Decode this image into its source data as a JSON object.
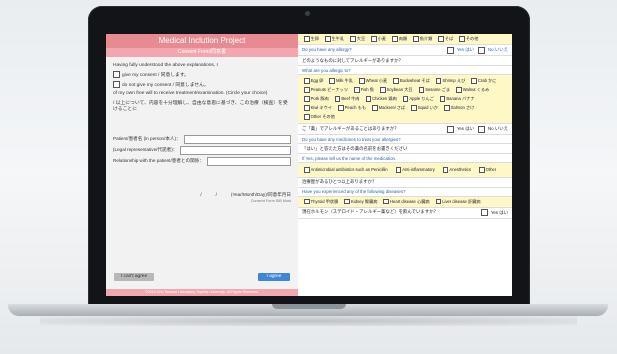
{
  "form": {
    "title": "Medical Inclution Project",
    "subtitle": "Consent Form/同意書",
    "intro": "Having fully understood the above explanations, I",
    "option1": "give my consent / 同意します。",
    "option2": "do not give my consent / 同意しません。",
    "treatment": "of my own free will to receive treatment/examination. (Circle your choice)",
    "jp_text": "/ 以上について、内容を十分理解し、自由な意思に基づき、この治療（検査）を受けることに",
    "patient_label": "Patient/患者名 (in person/本人)：",
    "rep_label": "(Legal representative/代諾者)：",
    "relation_label": "Relationship with the patient/患者との関係：",
    "date_slash1": "/",
    "date_slash2": "/",
    "date_label": "(Year/Month/Day)/同意年月日",
    "note": "Consent Form SiB Must",
    "cant_agree": "I can't agree",
    "agree": "I agree",
    "footer": "©2015 Ohu Takuma Laboratory, Sophia University, All Rights Reserved."
  },
  "right": {
    "q1_en": "Do you have any allergy?",
    "q1_jp": "どのようなものに対してアレルギーがありますか？",
    "q2_en": "What are you allergic to?",
    "q3_jp": "ご「薬」でアレルギーがあることはありますか？",
    "q3_en": "Do you have any medicines to treat your allergies?",
    "q4_jp": "「はい」と答えた方はその薬の名前をお書きください",
    "q4_en": "If Yes, please tell us the name of the medication.",
    "q5_jp": "治療歴があるひとつ以上ありますか？",
    "q5_en": "Have you experienced any of the following diseases?",
    "q6_jp": "現在ホルモン（ステロイド・アレルギー薬など）を飲んでいますか？",
    "yes": "Yes はい",
    "no": "No いいえ",
    "top_opts": [
      "生卵",
      "生牛乳",
      "大豆",
      "小麦",
      "肉類",
      "魚介類",
      "そば",
      "その他"
    ],
    "allergy_opts": [
      "Egg 卵",
      "Milk 牛乳",
      "Wheat 小麦",
      "Buckwheat そば",
      "Shrimp えび",
      "Crab かに",
      "Peanuts ピーナッツ",
      "Fish 魚",
      "Soybean 大豆",
      "Sesame ごま",
      "Walnut くるみ",
      "Pork 豚肉",
      "Beef 牛肉",
      "Chicken 鶏肉",
      "Apple りんご",
      "Banana バナナ",
      "Kiwi キウイ",
      "Peach もも",
      "Mackerel さば",
      "Squid いか",
      "Salmon さけ",
      "Other その他"
    ],
    "med_opts": [
      "Antimicrobial antibiotics such as Penicillin",
      "Anti-inflammatory",
      "Anesthetics",
      "Other"
    ],
    "disease_opts": [
      "Thyroid 甲状腺",
      "Kidney 腎臓病",
      "Heart disease 心臓病",
      "Liver disease 肝臓病"
    ]
  }
}
